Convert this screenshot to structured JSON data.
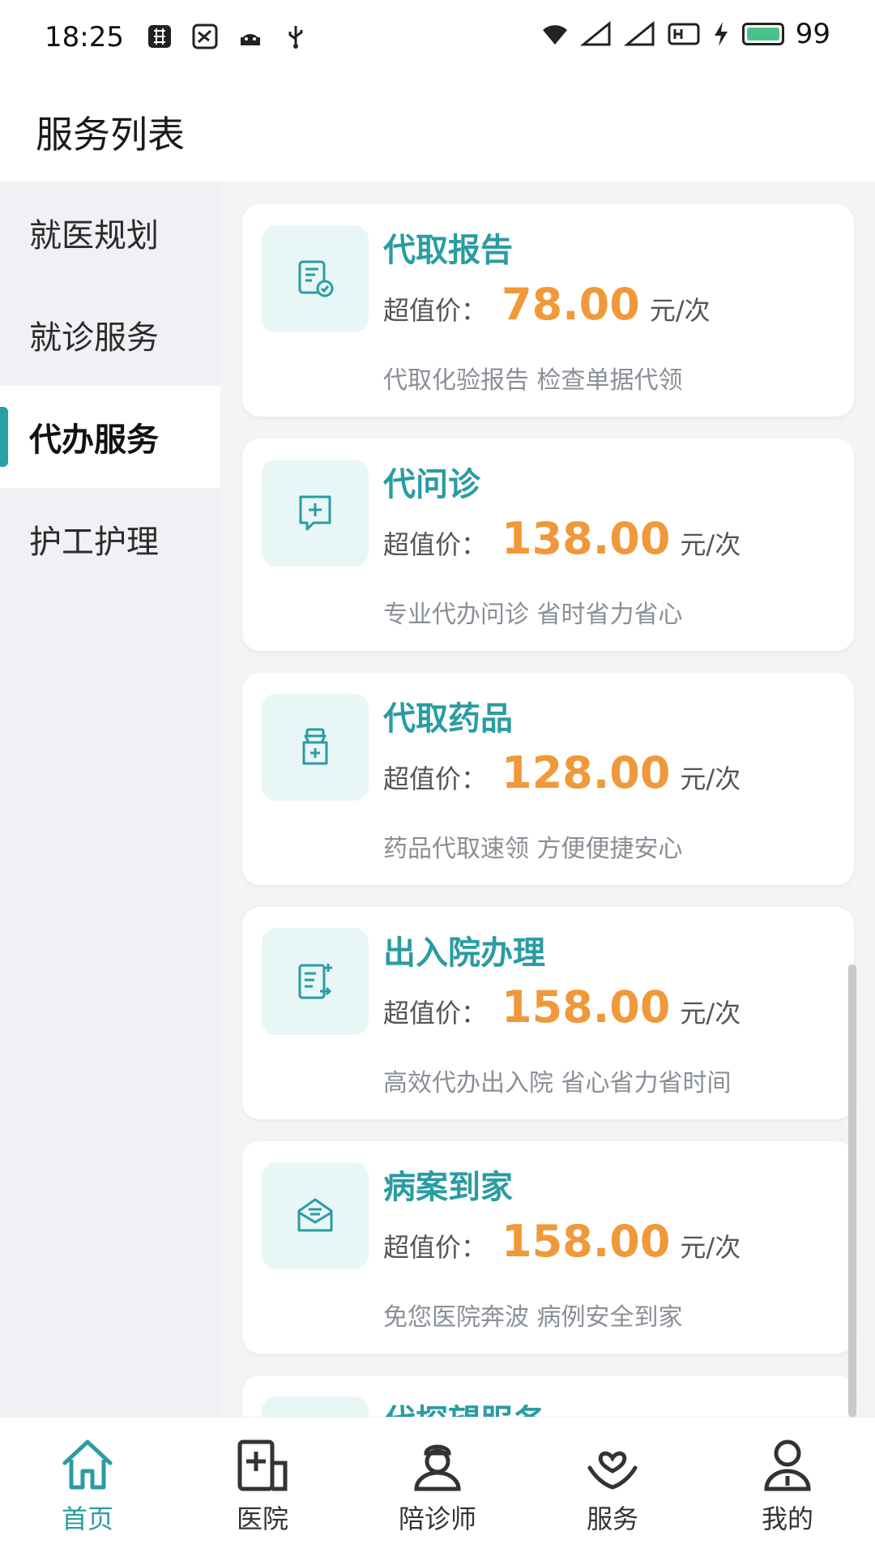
{
  "status_bar": {
    "time": "18:25",
    "battery": "99"
  },
  "header": {
    "title": "服务列表"
  },
  "sidebar": {
    "items": [
      {
        "label": "就医规划"
      },
      {
        "label": "就诊服务"
      },
      {
        "label": "代办服务"
      },
      {
        "label": "护工护理"
      }
    ],
    "active_index": 2
  },
  "services": [
    {
      "title": "代取报告",
      "price_label": "超值价：",
      "price": "78.00",
      "unit": "元/次",
      "desc": "代取化验报告 检查单据代领",
      "icon": "report-icon"
    },
    {
      "title": "代问诊",
      "price_label": "超值价：",
      "price": "138.00",
      "unit": "元/次",
      "desc": "专业代办问诊 省时省力省心",
      "icon": "consult-icon"
    },
    {
      "title": "代取药品",
      "price_label": "超值价：",
      "price": "128.00",
      "unit": "元/次",
      "desc": "药品代取速领 方便便捷安心",
      "icon": "medicine-icon"
    },
    {
      "title": "出入院办理",
      "price_label": "超值价：",
      "price": "158.00",
      "unit": "元/次",
      "desc": "高效代办出入院 省心省力省时间",
      "icon": "admission-icon"
    },
    {
      "title": "病案到家",
      "price_label": "超值价：",
      "price": "158.00",
      "unit": "元/次",
      "desc": "免您医院奔波 病例安全到家",
      "icon": "mail-icon"
    },
    {
      "title": "代探望服务",
      "price_label": "",
      "price": "",
      "unit": "",
      "desc": "",
      "icon": "visit-icon"
    }
  ],
  "tabbar": {
    "items": [
      {
        "label": "首页",
        "icon": "home-icon"
      },
      {
        "label": "医院",
        "icon": "hospital-icon"
      },
      {
        "label": "陪诊师",
        "icon": "nurse-icon"
      },
      {
        "label": "服务",
        "icon": "service-icon"
      },
      {
        "label": "我的",
        "icon": "profile-icon"
      }
    ],
    "active_index": 0
  },
  "colors": {
    "accent": "#2a9ca2",
    "price": "#f0993a",
    "sidebar_bg": "#eff1f4",
    "icon_bg": "#e9f6f6"
  }
}
